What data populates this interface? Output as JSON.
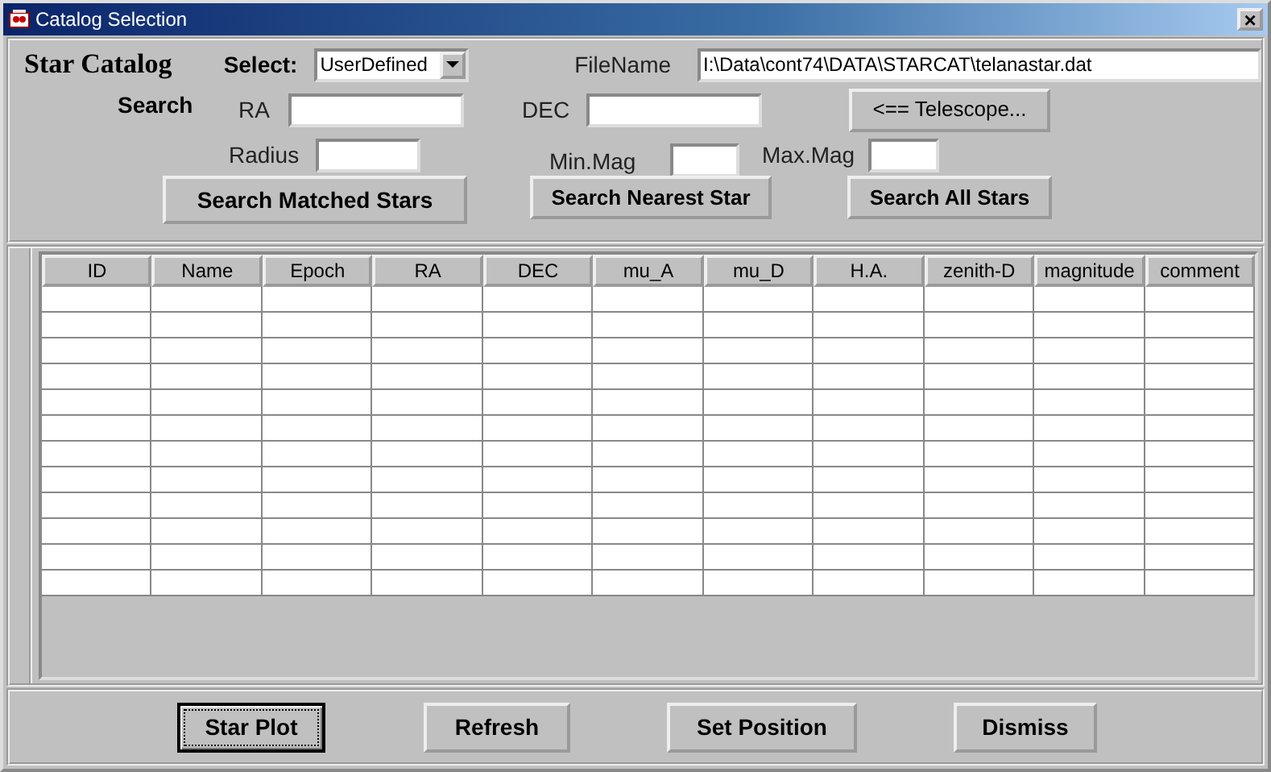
{
  "window": {
    "title": "Catalog Selection",
    "close": "×"
  },
  "header": {
    "title": "Star Catalog",
    "select_label": "Select:",
    "select_value": "UserDefined",
    "filename_label": "FileName",
    "filename_value": "I:\\Data\\cont74\\DATA\\STARCAT\\telanastar.dat"
  },
  "search": {
    "label": "Search",
    "ra_label": "RA",
    "dec_label": "DEC",
    "telescope_button": "<== Telescope...",
    "radius_label": "Radius",
    "min_mag_label": "Min.Mag",
    "max_mag_label": "Max.Mag"
  },
  "search_buttons": [
    "Search Matched Stars",
    "Search Nearest Star",
    "Search All Stars"
  ],
  "table": {
    "columns": [
      "ID",
      "Name",
      "Epoch",
      "RA",
      "DEC",
      "mu_A",
      "mu_D",
      "H.A.",
      "zenith-D",
      "magnitude",
      "comment"
    ]
  },
  "buttons": [
    {
      "label": "Star Plot",
      "focused": true
    },
    {
      "label": "Refresh",
      "focused": false
    },
    {
      "label": "Set Position",
      "focused": false
    },
    {
      "label": "Dismiss",
      "focused": false
    }
  ]
}
